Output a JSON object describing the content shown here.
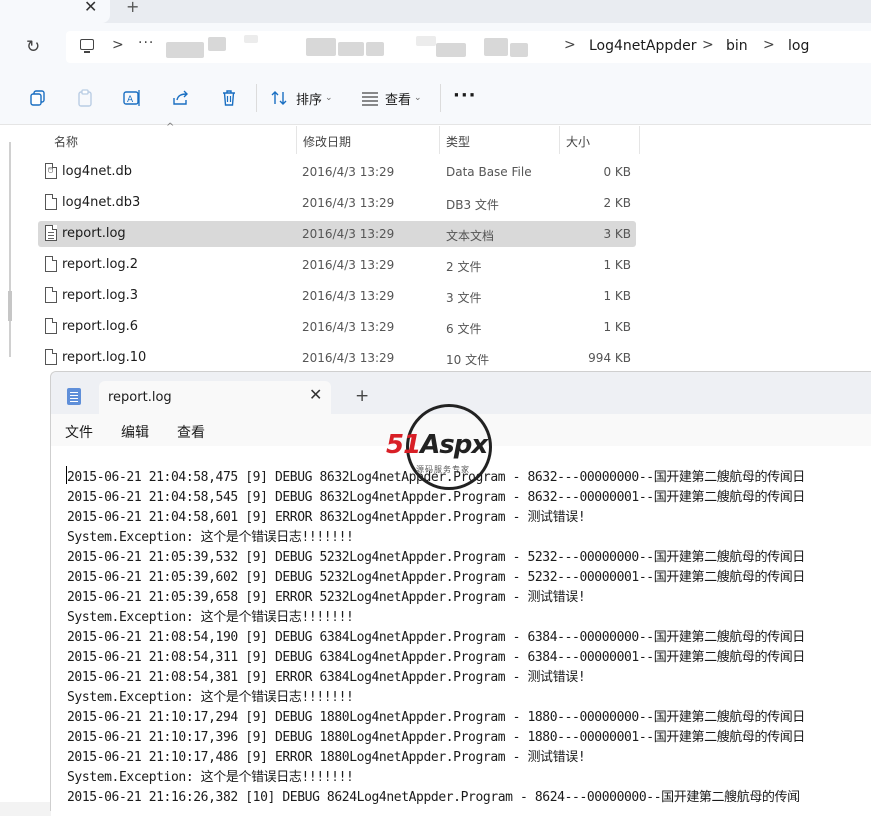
{
  "explorer": {
    "tab_close_glyph": "✕",
    "tab_add_glyph": "+",
    "refresh_glyph": "↻",
    "breadcrumb": {
      "more_glyph": "···",
      "separator": ">",
      "items": [
        "Log4netAppder",
        "bin",
        "log"
      ]
    },
    "toolbar": {
      "sort_label": "排序",
      "view_label": "查看",
      "more_glyph": "···"
    },
    "columns": {
      "name": "名称",
      "date": "修改日期",
      "type": "类型",
      "size": "大小"
    },
    "files": [
      {
        "name": "log4net.db",
        "date": "2016/4/3 13:29",
        "type": "Data Base File",
        "size": "0 KB",
        "selected": false
      },
      {
        "name": "log4net.db3",
        "date": "2016/4/3 13:29",
        "type": "DB3 文件",
        "size": "2 KB",
        "selected": false
      },
      {
        "name": "report.log",
        "date": "2016/4/3 13:29",
        "type": "文本文档",
        "size": "3 KB",
        "selected": true
      },
      {
        "name": "report.log.2",
        "date": "2016/4/3 13:29",
        "type": "2 文件",
        "size": "1 KB",
        "selected": false
      },
      {
        "name": "report.log.3",
        "date": "2016/4/3 13:29",
        "type": "3 文件",
        "size": "1 KB",
        "selected": false
      },
      {
        "name": "report.log.6",
        "date": "2016/4/3 13:29",
        "type": "6 文件",
        "size": "1 KB",
        "selected": false
      },
      {
        "name": "report.log.10",
        "date": "2016/4/3 13:29",
        "type": "10 文件",
        "size": "994 KB",
        "selected": false
      }
    ]
  },
  "notepad": {
    "tab_title": "report.log",
    "tab_close_glyph": "✕",
    "tab_add_glyph": "+",
    "menu": {
      "file": "文件",
      "edit": "编辑",
      "view": "查看"
    },
    "lines": [
      "2015-06-21 21:04:58,475 [9] DEBUG 8632Log4netAppder.Program - 8632---00000000--国开建第二艘航母的传闻日",
      "2015-06-21 21:04:58,545 [9] DEBUG 8632Log4netAppder.Program - 8632---00000001--国开建第二艘航母的传闻日",
      "2015-06-21 21:04:58,601 [9] ERROR 8632Log4netAppder.Program - 测试错误!",
      "System.Exception: 这个是个错误日志!!!!!!!",
      "2015-06-21 21:05:39,532 [9] DEBUG 5232Log4netAppder.Program - 5232---00000000--国开建第二艘航母的传闻日",
      "2015-06-21 21:05:39,602 [9] DEBUG 5232Log4netAppder.Program - 5232---00000001--国开建第二艘航母的传闻日",
      "2015-06-21 21:05:39,658 [9] ERROR 5232Log4netAppder.Program - 测试错误!",
      "System.Exception: 这个是个错误日志!!!!!!!",
      "2015-06-21 21:08:54,190 [9] DEBUG 6384Log4netAppder.Program - 6384---00000000--国开建第二艘航母的传闻日",
      "2015-06-21 21:08:54,311 [9] DEBUG 6384Log4netAppder.Program - 6384---00000001--国开建第二艘航母的传闻日",
      "2015-06-21 21:08:54,381 [9] ERROR 6384Log4netAppder.Program - 测试错误!",
      "System.Exception: 这个是个错误日志!!!!!!!",
      "2015-06-21 21:10:17,294 [9] DEBUG 1880Log4netAppder.Program - 1880---00000000--国开建第二艘航母的传闻日",
      "2015-06-21 21:10:17,396 [9] DEBUG 1880Log4netAppder.Program - 1880---00000001--国开建第二艘航母的传闻日",
      "2015-06-21 21:10:17,486 [9] ERROR 1880Log4netAppder.Program - 测试错误!",
      "System.Exception: 这个是个错误日志!!!!!!!",
      "2015-06-21 21:16:26,382 [10] DEBUG 8624Log4netAppder.Program - 8624---00000000--国开建第二艘航母的传闻"
    ]
  },
  "watermark": {
    "brand_red": "51",
    "brand_black": "Aspx",
    "tagline": "源码服务专家"
  }
}
